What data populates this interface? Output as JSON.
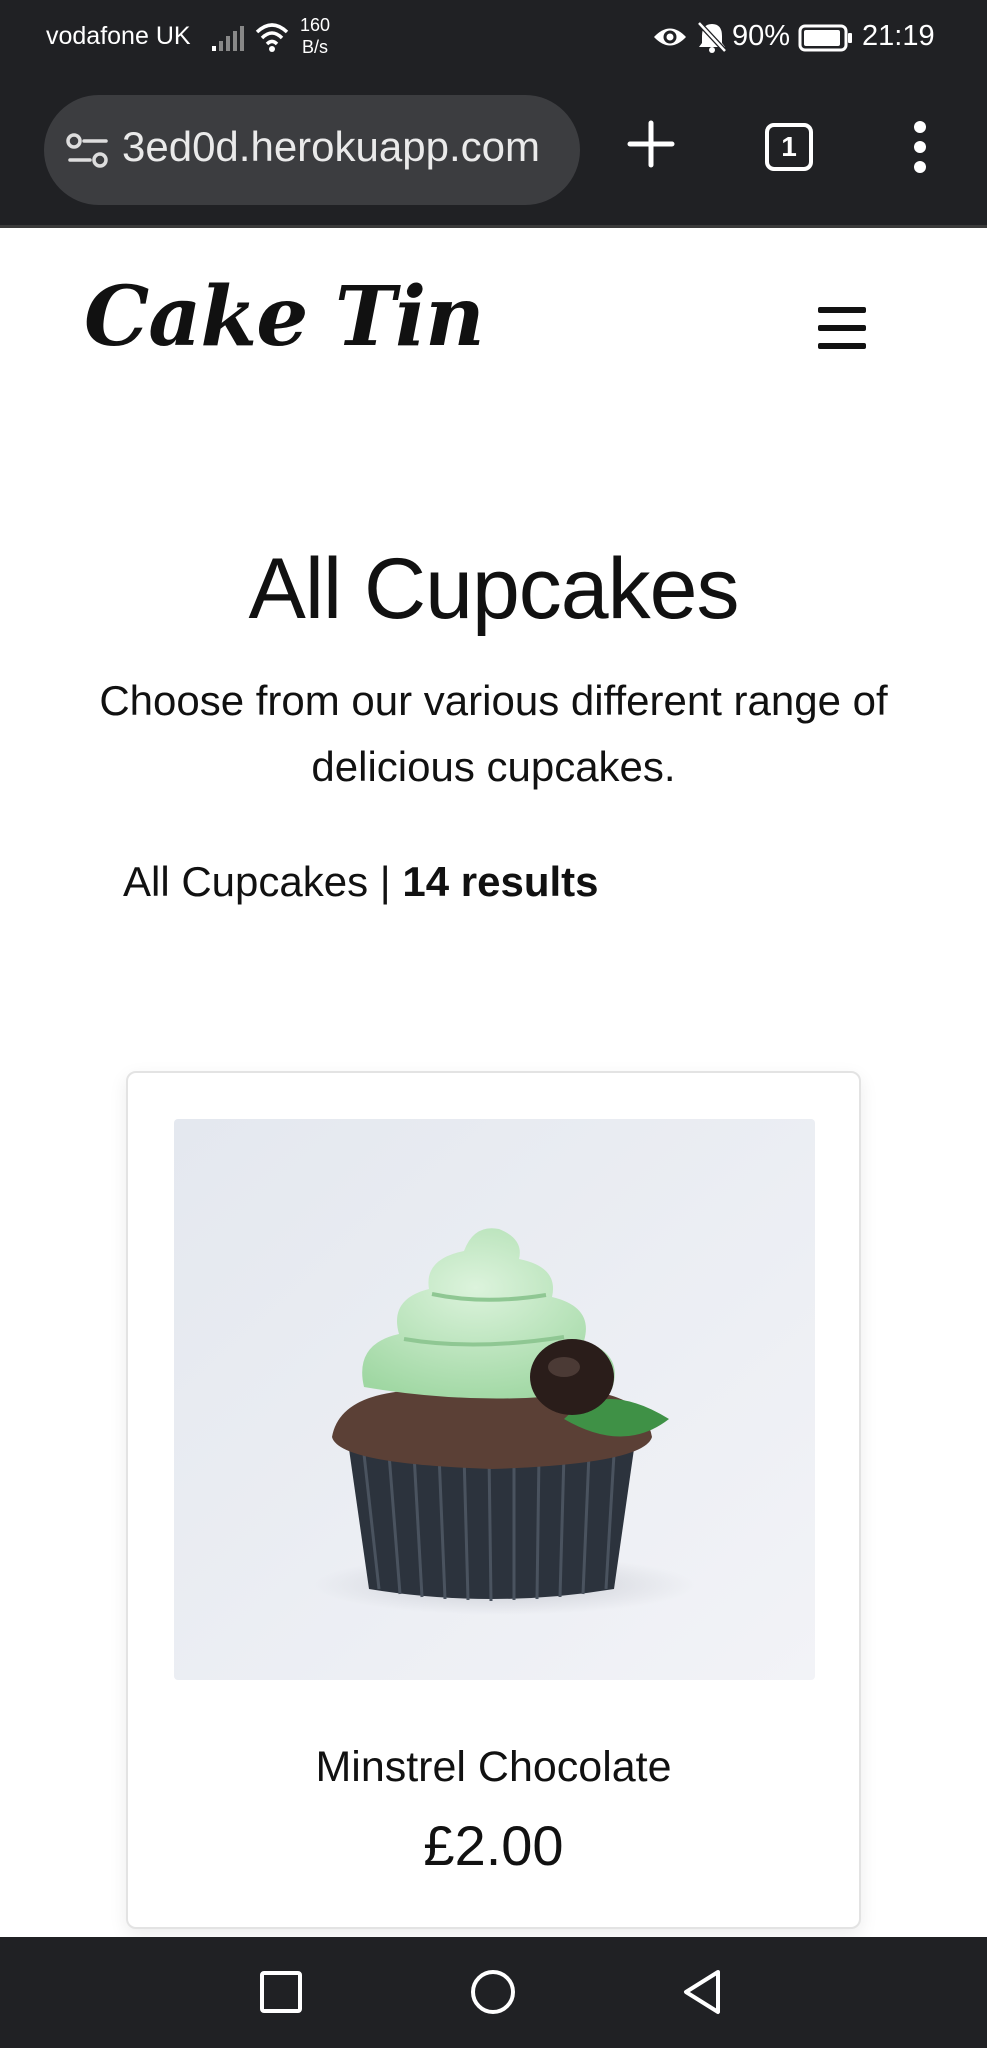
{
  "status_bar": {
    "carrier": "vodafone UK",
    "network_speed_value": "160",
    "network_speed_unit": "B/s",
    "battery_percent": "90%",
    "time": "21:19"
  },
  "browser": {
    "url": "3ed0d.herokuapp.com",
    "tab_count": "1"
  },
  "site": {
    "logo_text": "Cake Tin"
  },
  "page": {
    "title": "All Cupcakes",
    "subtitle": "Choose from our various different range of delicious cupcakes.",
    "results_category": "All Cupcakes |",
    "results_count": "14 results"
  },
  "products": [
    {
      "name": "Minstrel Chocolate",
      "price": "£2.00"
    }
  ],
  "colors": {
    "system_bar": "#202124",
    "url_pill": "#3c3d40",
    "text": "#111111",
    "card_border": "#e3e3e3"
  }
}
